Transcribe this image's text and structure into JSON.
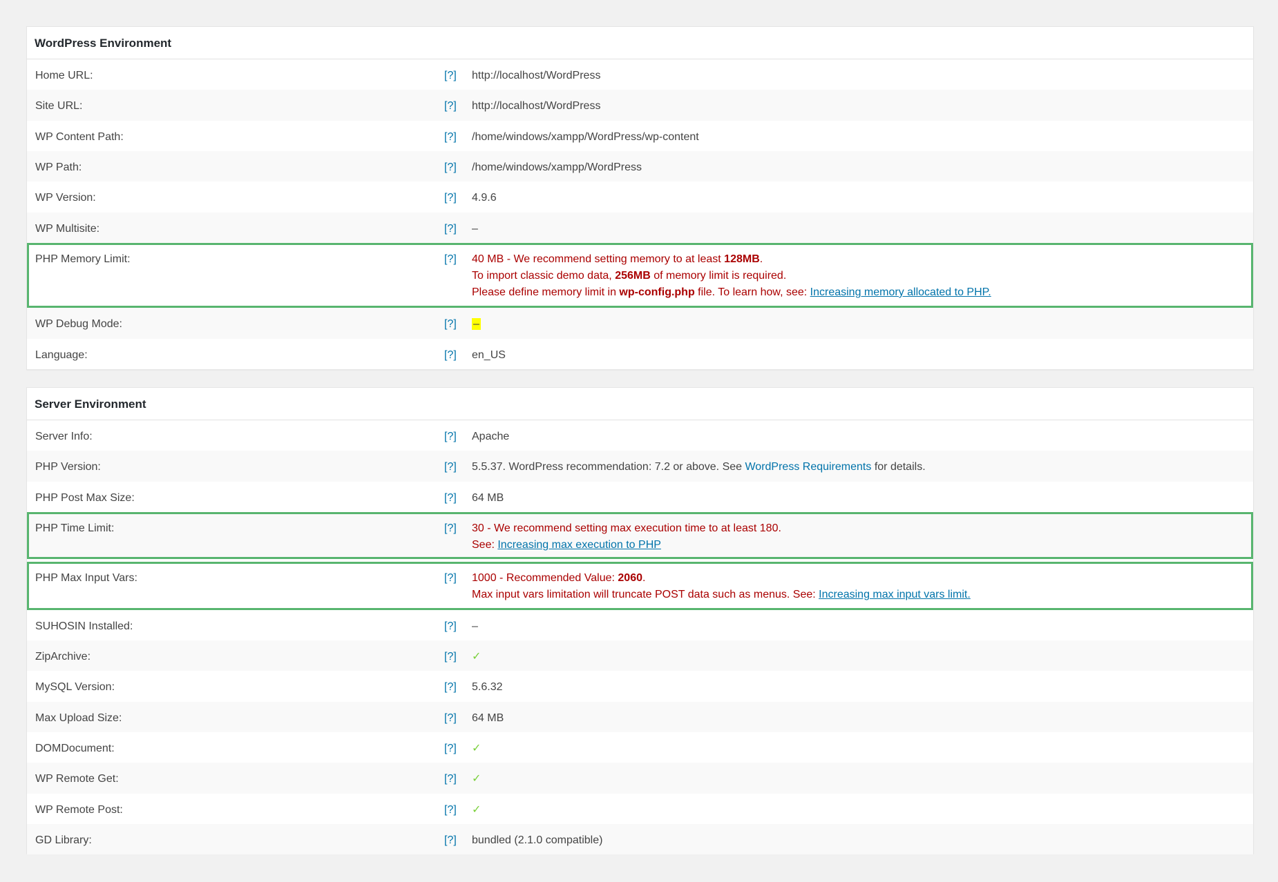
{
  "help_label": "[?]",
  "colors": {
    "flag_border": "#58b56f",
    "error": "#aa0000",
    "link": "#0073aa",
    "check": "#7ad03a"
  },
  "wp_env": {
    "title": "WordPress Environment",
    "home_url": {
      "label": "Home URL:",
      "value": "http://localhost/WordPress"
    },
    "site_url": {
      "label": "Site URL:",
      "value": "http://localhost/WordPress"
    },
    "content_path": {
      "label": "WP Content Path:",
      "value": "/home/windows/xampp/WordPress/wp-content"
    },
    "wp_path": {
      "label": "WP Path:",
      "value": "/home/windows/xampp/WordPress"
    },
    "wp_version": {
      "label": "WP Version:",
      "value": "4.9.6"
    },
    "multisite": {
      "label": "WP Multisite:",
      "value": "–"
    },
    "memory_limit": {
      "label": "PHP Memory Limit:",
      "l1_a": "40 MB - We recommend setting memory to at least ",
      "l1_b": "128MB",
      "l1_c": ".",
      "l2_a": "To import classic demo data, ",
      "l2_b": "256MB",
      "l2_c": " of memory limit is required.",
      "l3_a": "Please define memory limit in ",
      "l3_b": "wp-config.php",
      "l3_c": " file. To learn how, see: ",
      "l3_link": "Increasing memory allocated to PHP."
    },
    "debug_mode": {
      "label": "WP Debug Mode:",
      "value": "–"
    },
    "language": {
      "label": "Language:",
      "value": "en_US"
    }
  },
  "server_env": {
    "title": "Server Environment",
    "server_info": {
      "label": "Server Info:",
      "value": "Apache"
    },
    "php_version": {
      "label": "PHP Version:",
      "value_a": "5.5.37. WordPress recommendation: 7.2 or above. See ",
      "value_link": "WordPress Requirements",
      "value_c": " for details."
    },
    "post_max": {
      "label": "PHP Post Max Size:",
      "value": "64 MB"
    },
    "time_limit": {
      "label": "PHP Time Limit:",
      "l1": "30 - We recommend setting max execution time to at least 180.",
      "l2_a": "See: ",
      "l2_link": "Increasing max execution to PHP"
    },
    "max_input_vars": {
      "label": "PHP Max Input Vars:",
      "l1_a": "1000 - Recommended Value: ",
      "l1_b": "2060",
      "l1_c": ".",
      "l2_a": "Max input vars limitation will truncate POST data such as menus. See: ",
      "l2_link": "Increasing max input vars limit."
    },
    "suhosin": {
      "label": "SUHOSIN Installed:",
      "value": "–"
    },
    "ziparchive": {
      "label": "ZipArchive:",
      "value": "✓"
    },
    "mysql": {
      "label": "MySQL Version:",
      "value": "5.6.32"
    },
    "upload": {
      "label": "Max Upload Size:",
      "value": "64 MB"
    },
    "domdocument": {
      "label": "DOMDocument:",
      "value": "✓"
    },
    "remote_get": {
      "label": "WP Remote Get:",
      "value": "✓"
    },
    "remote_post": {
      "label": "WP Remote Post:",
      "value": "✓"
    },
    "gd": {
      "label": "GD Library:",
      "value": "bundled (2.1.0 compatible)"
    }
  }
}
